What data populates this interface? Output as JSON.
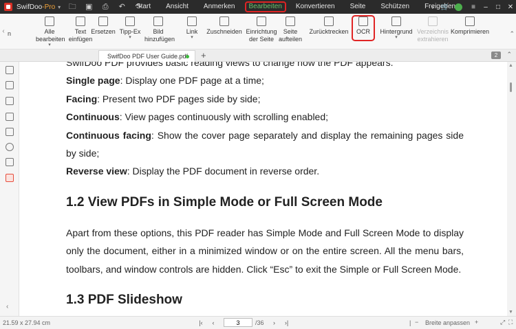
{
  "app": {
    "name": "SwifDoo",
    "suffix": "-Pro"
  },
  "menu": [
    {
      "label": "Start"
    },
    {
      "label": "Ansicht"
    },
    {
      "label": "Anmerken"
    },
    {
      "label": "Bearbeiten",
      "active": true
    },
    {
      "label": "Konvertieren"
    },
    {
      "label": "Seite"
    },
    {
      "label": "Schützen"
    },
    {
      "label": "Freigeben"
    }
  ],
  "ribbon": {
    "left_label": "n",
    "items": [
      {
        "line1": "Alle",
        "line2": "bearbeiten",
        "icon": "edit-all-icon",
        "dropdown": true
      },
      {
        "line1": "Text",
        "line2": "einfügen",
        "icon": "text-insert-icon"
      },
      {
        "line1": "Ersetzen",
        "line2": "",
        "icon": "replace-icon"
      },
      {
        "line1": "Tipp-Ex",
        "line2": "",
        "icon": "whiteout-icon",
        "dropdown": true
      },
      {
        "line1": "Bild",
        "line2": "hinzufügen",
        "icon": "image-icon"
      },
      {
        "line1": "Link",
        "line2": "",
        "icon": "link-icon",
        "dropdown": true
      },
      {
        "line1": "Zuschneiden",
        "line2": "",
        "icon": "crop-icon"
      },
      {
        "line1": "Einrichtung",
        "line2": "der Seite",
        "icon": "page-setup-icon"
      },
      {
        "line1": "Seite",
        "line2": "aufteilen",
        "icon": "split-page-icon"
      },
      {
        "line1": "Zurücktrecken",
        "line2": "",
        "icon": "straighten-icon"
      },
      {
        "line1": "OCR",
        "line2": "",
        "icon": "ocr-icon",
        "highlight": true
      },
      {
        "line1": "Hintergrund",
        "line2": "",
        "icon": "background-icon",
        "dropdown": true
      },
      {
        "line1": "Verzeichnis",
        "line2": "extrahieren",
        "icon": "toc-icon",
        "disabled": true
      },
      {
        "line1": "Komprimieren",
        "line2": "",
        "icon": "compress-icon"
      }
    ]
  },
  "tabs": {
    "document": "SwifDoo PDF User Guide.pdf",
    "count": "2"
  },
  "document": {
    "paragraphs_top": [
      {
        "bold": "",
        "text": "SwifDoo PDF provides basic reading views to change how the PDF appears."
      },
      {
        "bold": "Single page",
        "text": ": Display one PDF page at a time;"
      },
      {
        "bold": "Facing",
        "text": ": Present two PDF pages side by side;"
      },
      {
        "bold": "Continuous",
        "text": ": View pages continuously with scrolling enabled;"
      },
      {
        "bold": "Continuous facing",
        "text": ": Show the cover page separately and display the remaining pages side by side;"
      },
      {
        "bold": "Reverse view",
        "text": ": Display the PDF document in reverse order."
      }
    ],
    "heading1": "1.2 View PDFs in Simple Mode or Full Screen Mode",
    "body": "Apart from these options, this PDF reader has Simple Mode and Full Screen Mode to display only the document, either in a minimized window or on the entire screen. All the menu bars, toolbars, and window controls are hidden. Click “Esc” to exit the Simple or Full Screen Mode.",
    "heading2": "1.3 PDF Slideshow"
  },
  "status": {
    "page_size": "21.59 x 27.94 cm",
    "current_page": "3",
    "total_pages": "/36",
    "zoom_mode": "Breite anpassen"
  }
}
